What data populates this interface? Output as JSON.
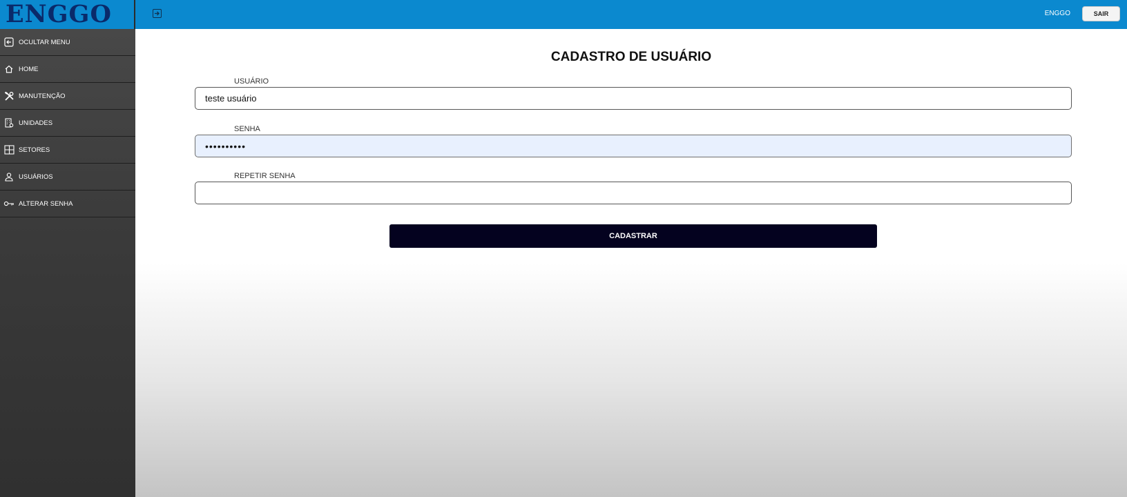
{
  "app": {
    "logo": "ENGGO",
    "username": "ENGGO",
    "logout_label": "SAIR"
  },
  "sidebar": {
    "items": [
      {
        "label": "OCULTAR MENU",
        "icon": "hide-menu-icon"
      },
      {
        "label": "HOME",
        "icon": "home-icon"
      },
      {
        "label": "MANUTENÇÃO",
        "icon": "tools-icon"
      },
      {
        "label": "UNIDADES",
        "icon": "building-icon"
      },
      {
        "label": "SETORES",
        "icon": "grid-icon"
      },
      {
        "label": "USUÁRIOS",
        "icon": "user-icon"
      },
      {
        "label": "ALTERAR SENHA",
        "icon": "key-icon"
      }
    ]
  },
  "form": {
    "title": "CADASTRO DE USUÁRIO",
    "usuario": {
      "label": "USUÁRIO",
      "value": "teste usuário"
    },
    "senha": {
      "label": "SENHA",
      "value": "••••••••••"
    },
    "repetir_senha": {
      "label": "REPETIR SENHA",
      "value": ""
    },
    "submit_label": "CADASTRAR"
  },
  "colors": {
    "topbar": "#0b89cf",
    "logo": "#0a2a6a",
    "sidebar": "#3a3a3a",
    "submit_button": "#04021f",
    "active_field": "#e8f0fe"
  }
}
